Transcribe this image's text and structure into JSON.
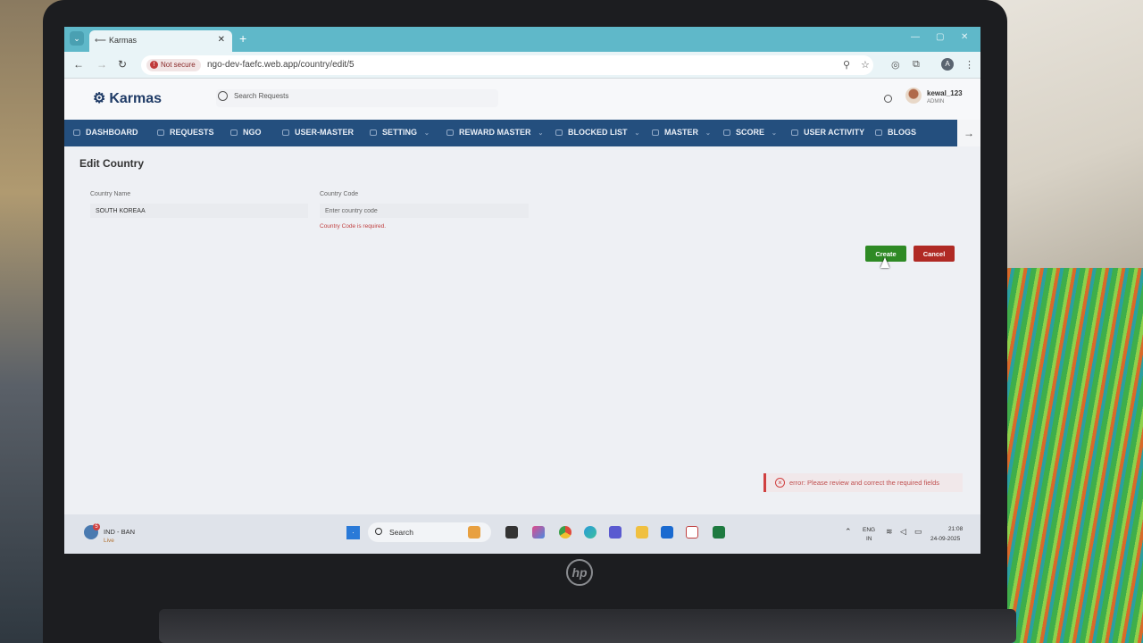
{
  "browser": {
    "tab_title": "Karmas",
    "security_label": "Not secure",
    "url": "ngo-dev-faefc.web.app/country/edit/5",
    "profile_initial": "A"
  },
  "app": {
    "brand": "Karmas",
    "search_placeholder": "Search Requests",
    "user_name": "kewal_123",
    "user_role": "ADMIN"
  },
  "nav": {
    "items": [
      {
        "label": "DASHBOARD"
      },
      {
        "label": "REQUESTS"
      },
      {
        "label": "NGO"
      },
      {
        "label": "USER-MASTER"
      },
      {
        "label": "SETTING"
      },
      {
        "label": "REWARD MASTER"
      },
      {
        "label": "BLOCKED LIST"
      },
      {
        "label": "MASTER"
      },
      {
        "label": "SCORE"
      },
      {
        "label": "USER ACTIVITY"
      },
      {
        "label": "BLOGS"
      }
    ]
  },
  "form": {
    "title": "Edit Country",
    "country_name_label": "Country Name",
    "country_name_value": "SOUTH KOREAA",
    "country_code_label": "Country Code",
    "country_code_placeholder": "Enter country code",
    "country_code_error": "Country Code is required.",
    "create_label": "Create",
    "cancel_label": "Cancel"
  },
  "toast": {
    "message": "error: Please review and correct the required fields"
  },
  "taskbar": {
    "weather_title": "IND - BAN",
    "weather_sub": "Live",
    "weather_badge": "5",
    "search_label": "Search",
    "lang_top": "ENG",
    "lang_bottom": "IN",
    "time": "21:08",
    "date": "24-09-2025"
  },
  "colors": {
    "nav_bg": "#244f7e",
    "create": "#2e8a24",
    "cancel": "#b02a24",
    "error": "#c04040"
  }
}
